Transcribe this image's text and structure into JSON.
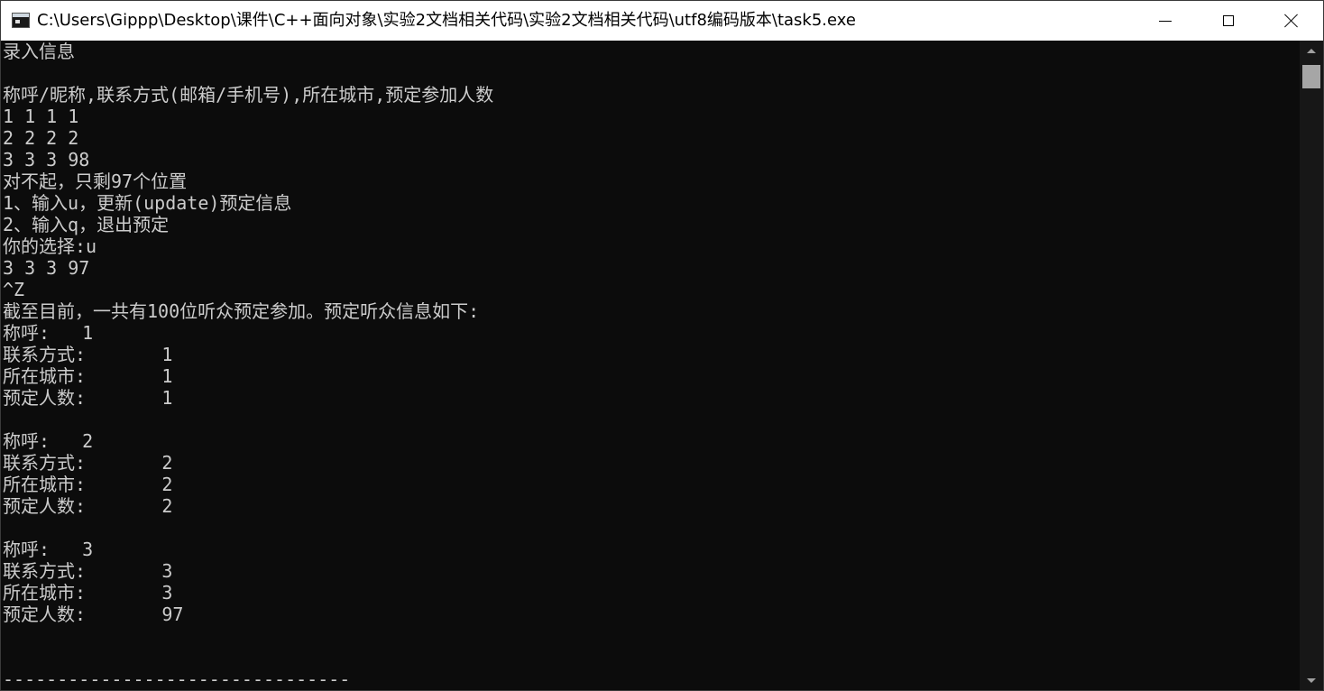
{
  "window": {
    "title": "C:\\Users\\Gippp\\Desktop\\课件\\C++面向对象\\实验2文档相关代码\\实验2文档相关代码\\utf8编码版本\\task5.exe"
  },
  "console": {
    "lines": [
      "录入信息",
      "",
      "称呼/昵称,联系方式(邮箱/手机号),所在城市,预定参加人数",
      "1 1 1 1",
      "2 2 2 2",
      "3 3 3 98",
      "对不起，只剩97个位置",
      "1、输入u，更新(update)预定信息",
      "2、输入q，退出预定",
      "你的选择:u",
      "3 3 3 97",
      "^Z",
      "截至目前，一共有100位听众预定参加。预定听众信息如下:",
      "称呼:   1",
      "联系方式:       1",
      "所在城市:       1",
      "预定人数:       1",
      "",
      "称呼:   2",
      "联系方式:       2",
      "所在城市:       2",
      "预定人数:       2",
      "",
      "称呼:   3",
      "联系方式:       3",
      "所在城市:       3",
      "预定人数:       97",
      "",
      "",
      "--------------------------------"
    ]
  }
}
